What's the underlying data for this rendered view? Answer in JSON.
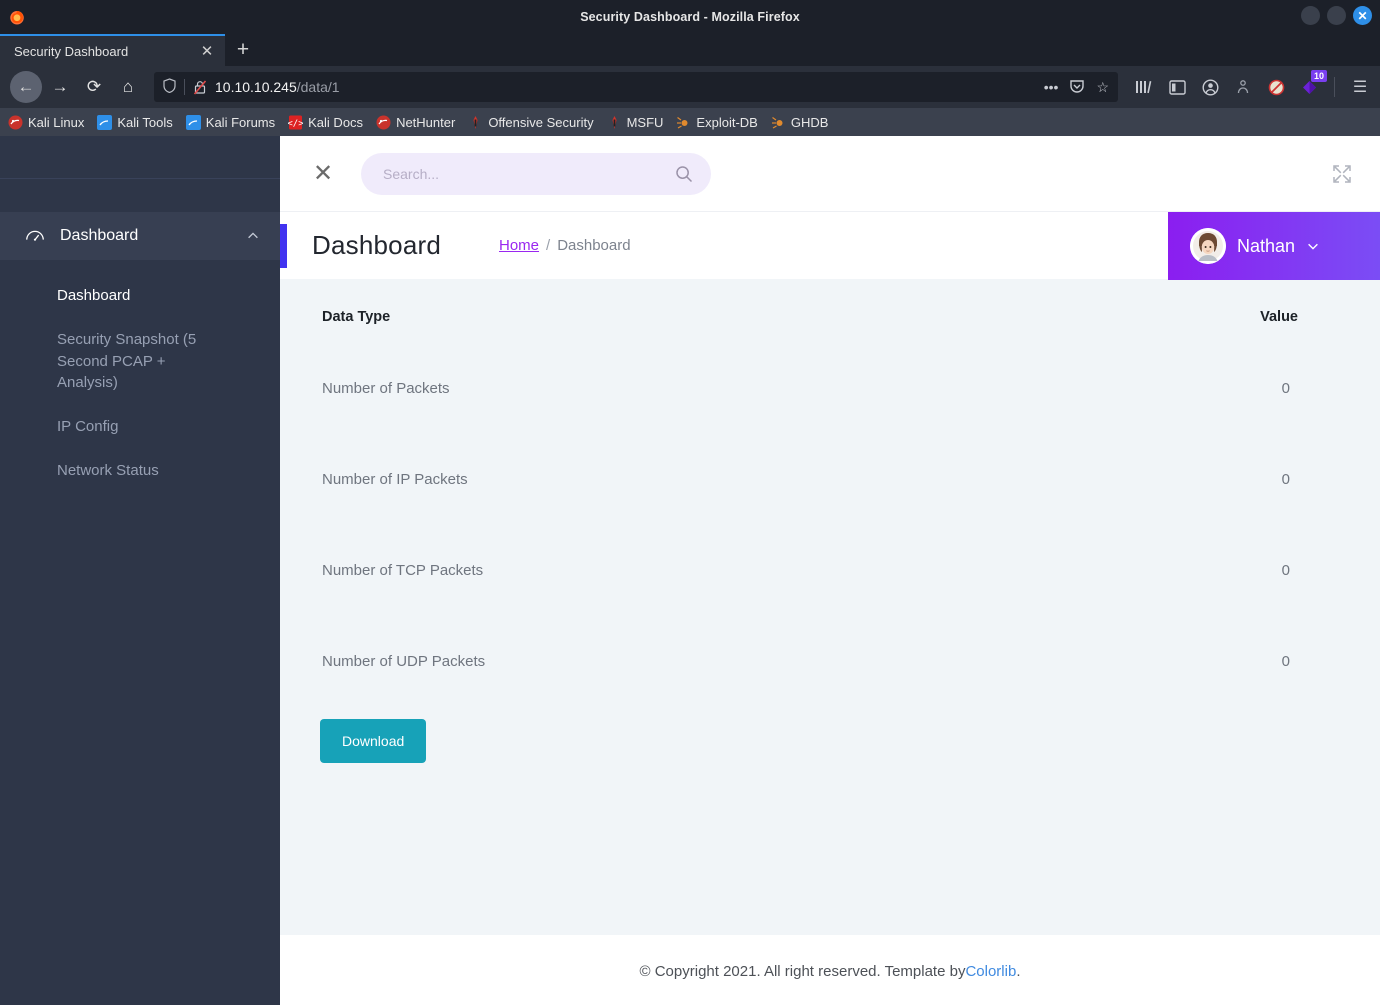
{
  "browser": {
    "window_title": "Security Dashboard - Mozilla Firefox",
    "tab_title": "Security Dashboard",
    "tab_close_glyph": "✕",
    "new_tab_glyph": "+",
    "window_buttons": {
      "minimize": "",
      "maximize": "",
      "close": "✕"
    },
    "nav": {
      "back": "←",
      "forward": "→",
      "reload": "⟳",
      "home": "⌂"
    },
    "url": {
      "host": "10.10.10.245",
      "path": "/data/1"
    },
    "url_actions": {
      "more": "•••",
      "pocket": "pocket-icon",
      "bookmark": "☆"
    },
    "toolbar_icons": [
      {
        "name": "library-icon",
        "glyph": "|||\\"
      },
      {
        "name": "sidebar-icon",
        "glyph": "▤"
      },
      {
        "name": "account-icon",
        "glyph": "◉"
      },
      {
        "name": "container-icon",
        "glyph": "⚇"
      },
      {
        "name": "noscript-icon",
        "glyph": "⃠"
      },
      {
        "name": "extension-icon",
        "glyph": "◆",
        "badge": "10"
      },
      {
        "name": "menu-icon",
        "glyph": "☰"
      }
    ],
    "bookmarks": [
      {
        "label": "Kali Linux",
        "icon": "kali-dragon-icon"
      },
      {
        "label": "Kali Tools",
        "icon": "kali-tools-icon"
      },
      {
        "label": "Kali Forums",
        "icon": "kali-forums-icon"
      },
      {
        "label": "Kali Docs",
        "icon": "kali-docs-icon"
      },
      {
        "label": "NetHunter",
        "icon": "nethunter-icon"
      },
      {
        "label": "Offensive Security",
        "icon": "offsec-icon"
      },
      {
        "label": "MSFU",
        "icon": "msfu-icon"
      },
      {
        "label": "Exploit-DB",
        "icon": "exploitdb-icon"
      },
      {
        "label": "GHDB",
        "icon": "ghdb-icon"
      }
    ]
  },
  "sidebar": {
    "section": {
      "label": "Dashboard",
      "icon": "gauge-icon",
      "collapse_icon": "chevron-up-icon"
    },
    "items": [
      {
        "label": "Dashboard",
        "active": true
      },
      {
        "label": "Security Snapshot (5 Second PCAP + Analysis)",
        "active": false
      },
      {
        "label": "IP Config",
        "active": false
      },
      {
        "label": "Network Status",
        "active": false
      }
    ]
  },
  "topbar": {
    "close_glyph": "✕",
    "search": {
      "value": "",
      "placeholder": "Search...",
      "icon": "search-icon"
    },
    "expand_icon": "fullscreen-expand-icon"
  },
  "header": {
    "page_title": "Dashboard",
    "breadcrumb": {
      "home": "Home",
      "separator": "/",
      "current": "Dashboard"
    },
    "user": {
      "name": "Nathan",
      "avatar": "user-avatar",
      "caret": "chevron-down-icon"
    },
    "accent_color": "#4133f0",
    "user_gradient_from": "#8b1ef0",
    "user_gradient_to": "#7b4df5"
  },
  "table": {
    "columns": [
      "Data Type",
      "Value"
    ],
    "rows": [
      {
        "type": "Number of Packets",
        "value": "0"
      },
      {
        "type": "Number of IP Packets",
        "value": "0"
      },
      {
        "type": "Number of TCP Packets",
        "value": "0"
      },
      {
        "type": "Number of UDP Packets",
        "value": "0"
      }
    ]
  },
  "actions": {
    "download_label": "Download",
    "download_color": "#17a2b8"
  },
  "footer": {
    "text_before": "© Copyright 2021. All right reserved. Template by ",
    "link": "Colorlib",
    "text_after": "."
  }
}
